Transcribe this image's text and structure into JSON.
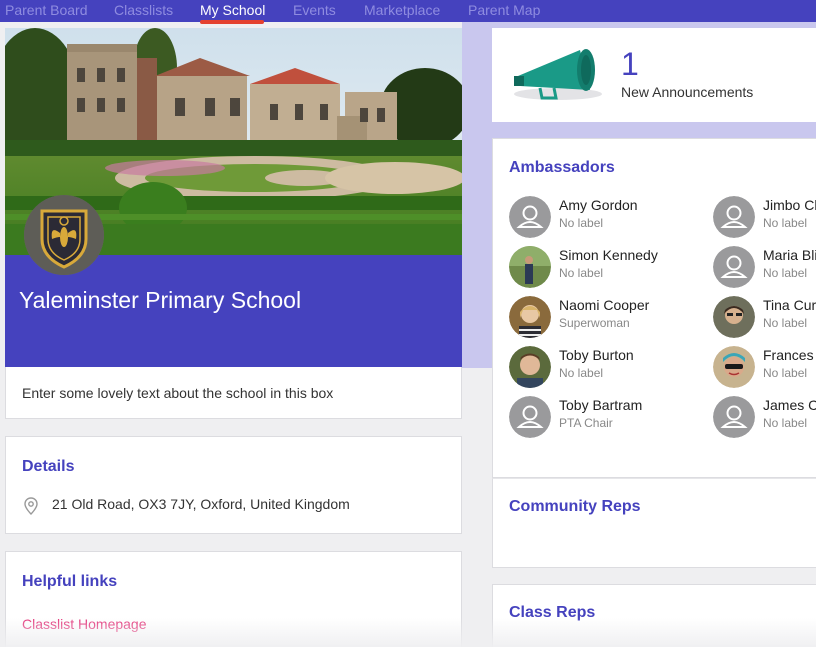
{
  "nav": {
    "items": [
      {
        "label": "Parent Board"
      },
      {
        "label": "Classlists"
      },
      {
        "label": "My School"
      },
      {
        "label": "Events"
      },
      {
        "label": "Marketplace"
      },
      {
        "label": "Parent Map"
      }
    ],
    "active": "My School"
  },
  "school": {
    "name": "Yaleminster Primary School",
    "about": "Enter some lovely text about the school in this box"
  },
  "details": {
    "title": "Details",
    "address": "21 Old Road, OX3 7JY, Oxford, United Kingdom"
  },
  "links": {
    "title": "Helpful links",
    "items": [
      {
        "label": "Classlist Homepage"
      }
    ]
  },
  "announcements": {
    "count": "1",
    "label": "New Announcements"
  },
  "ambassadors": {
    "title": "Ambassadors",
    "people": [
      {
        "name": "Amy Gordon",
        "label": "No label",
        "avatar": "default-avatar"
      },
      {
        "name": "Jimbo Cl",
        "label": "No label",
        "avatar": "default-avatar"
      },
      {
        "name": "Simon Kennedy",
        "label": "No label",
        "avatar": "photo-outdoor"
      },
      {
        "name": "Maria Bli",
        "label": "No label",
        "avatar": "default-avatar"
      },
      {
        "name": "Naomi Cooper",
        "label": "Superwoman",
        "avatar": "photo-woman-blonde"
      },
      {
        "name": "Tina Curt",
        "label": "No label",
        "avatar": "photo-woman-dark"
      },
      {
        "name": "Toby Burton",
        "label": "No label",
        "avatar": "photo-man"
      },
      {
        "name": "Frances",
        "label": "No label",
        "avatar": "photo-woman-sunglasses"
      },
      {
        "name": "Toby Bartram",
        "label": "PTA Chair",
        "avatar": "default-avatar"
      },
      {
        "name": "James C",
        "label": "No label",
        "avatar": "default-avatar"
      }
    ]
  },
  "community": {
    "title": "Community Reps"
  },
  "class_reps": {
    "title": "Class Reps"
  },
  "colors": {
    "brand": "#4542be",
    "accent": "#e4412f",
    "link": "#e4397d",
    "teal": "#1a9a87"
  }
}
